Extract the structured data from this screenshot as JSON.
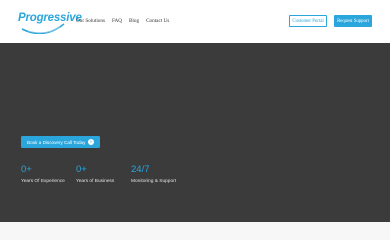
{
  "brand": {
    "logo_text": "Progressive",
    "accent_color": "#2aa6dc"
  },
  "nav": {
    "items": [
      {
        "label": "Our Solutions"
      },
      {
        "label": "FAQ"
      },
      {
        "label": "Blog"
      },
      {
        "label": "Contact Us"
      }
    ]
  },
  "header_buttons": {
    "portal_label": "Customer Portal",
    "support_label": "Request Support"
  },
  "hero": {
    "background_color": "#3b3b3b",
    "cta_label": "Book a Discovery Call Today",
    "cta_icon": "arrow-right-circle-icon"
  },
  "stats": [
    {
      "value": "0+",
      "label": "Years Of Experience"
    },
    {
      "value": "0+",
      "label": "Years of Business"
    },
    {
      "value": "24/7",
      "label": "Monitoring & Support"
    }
  ]
}
